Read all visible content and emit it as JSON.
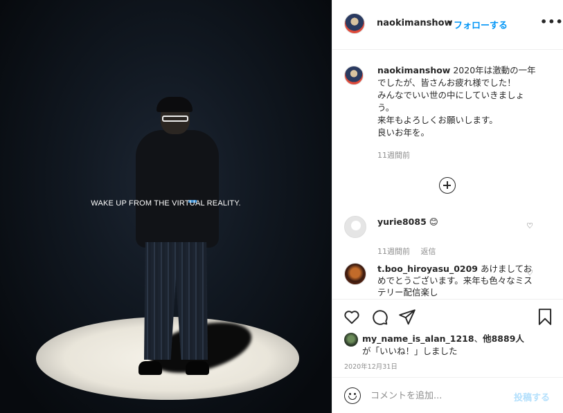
{
  "photo": {
    "tagline": "WAKE UP FROM THE VIRTUAL REALITY."
  },
  "header": {
    "username": "naokimanshow",
    "separator": "•",
    "follow_label": "フォローする",
    "more_label": "•••"
  },
  "caption": {
    "username": "naokimanshow",
    "text": "2020年は激動の一年でしたが、皆さんお疲れ様でした！みんなでいい世の中にしていきましょう。来年もよろしくお願いします。良いお年を。",
    "lines": [
      "2020年は激動の一年",
      "でしたが、皆さんお疲れ様でした！",
      "みんなでいい世の中にしていきましょ",
      "う。",
      "来年もよろしくお願いします。",
      "良いお年を。"
    ],
    "time": "11週間前"
  },
  "comments": [
    {
      "username": "yurie8085",
      "text": "😊",
      "time": "11週間前",
      "reply_label": "返信"
    },
    {
      "username": "t.boo_hiroyasu_0209",
      "text": "あけましておめでとうございます。来年も色々なミステリー配信楽し"
    }
  ],
  "actions": {
    "icons": [
      "heart-icon",
      "comment-icon",
      "share-icon",
      "bookmark-icon"
    ]
  },
  "likes": {
    "liker": "my_name_is_alan_1218",
    "suffix_1": "、",
    "others": "他8889人",
    "suffix_2": "が「いいね！」しました"
  },
  "date": "2020年12月31日",
  "composer": {
    "placeholder": "コメントを追加...",
    "post_label": "投稿する"
  },
  "colors": {
    "accent": "#0095f6",
    "post_disabled": "#b2dffc",
    "muted": "#8e8e8e"
  }
}
